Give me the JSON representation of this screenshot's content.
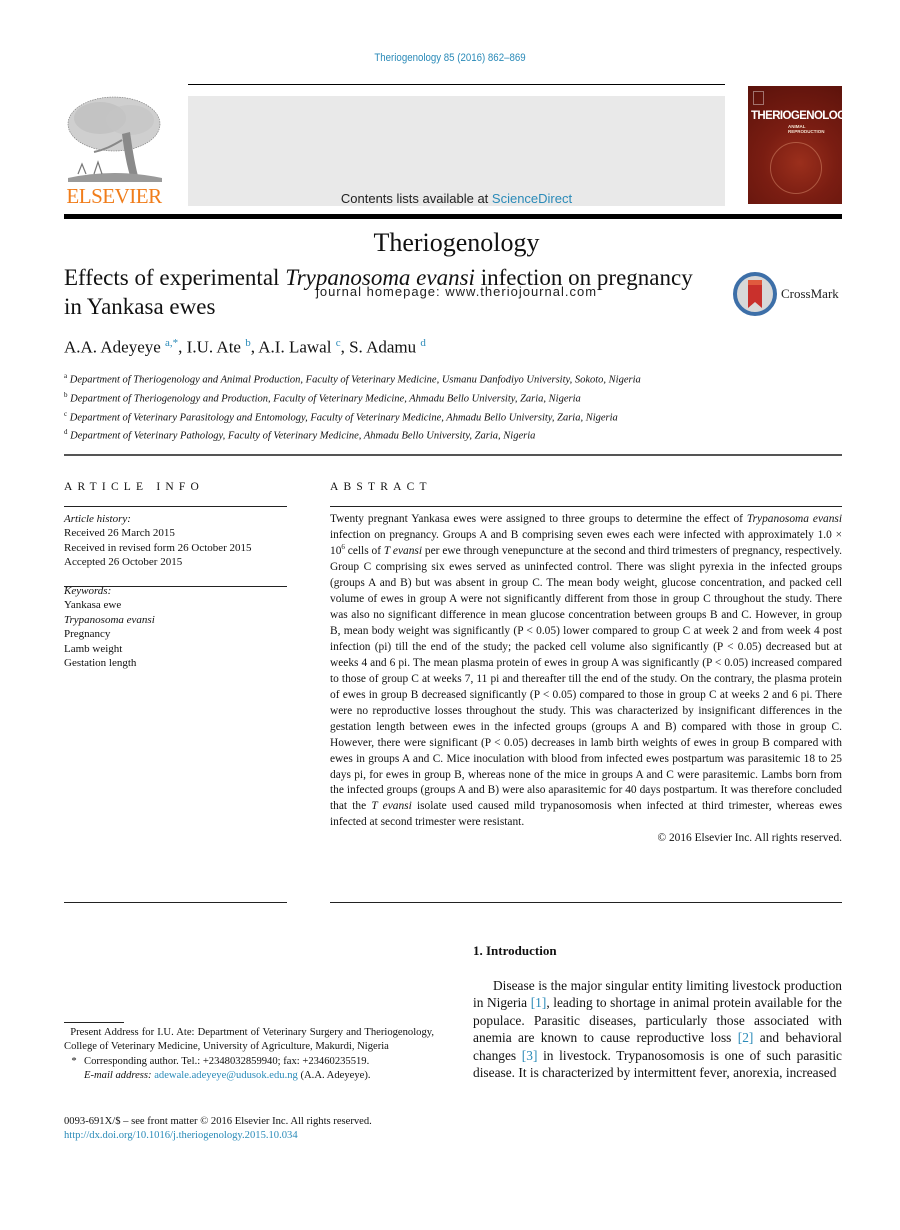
{
  "header": {
    "citation": "Theriogenology 85 (2016) 862–869",
    "contents_prefix": "Contents lists available at ",
    "contents_link": "ScienceDirect",
    "journal_name": "Theriogenology",
    "homepage": "journal homepage: www.theriojournal.com",
    "publisher_logo_text": "ELSEVIER",
    "cover_title": "THERIOGENOLOGY",
    "cover_subtitle": "ANIMAL REPRODUCTION",
    "colors": {
      "link": "#2a8ab8",
      "elsevier_orange": "#f07d1b",
      "masthead_bg": "#e9e9e9",
      "cover": "#7a1d12"
    }
  },
  "article": {
    "title_part1": "Effects of experimental ",
    "title_italic": "Trypanosoma evansi",
    "title_part2": " infection on pregnancy in Yankasa ewes",
    "crossmark_label": "CrossMark",
    "authors": [
      {
        "name": "A.A. Adeyeye",
        "sup": "a,*"
      },
      {
        "name": "I.U. Ate",
        "sup": "b"
      },
      {
        "name": "A.I. Lawal",
        "sup": "c"
      },
      {
        "name": "S. Adamu",
        "sup": "d"
      }
    ],
    "affiliations": [
      {
        "sup": "a",
        "text": "Department of Theriogenology and Animal Production, Faculty of Veterinary Medicine, Usmanu Danfodiyo University, Sokoto, Nigeria"
      },
      {
        "sup": "b",
        "text": "Department of Theriogenology and Production, Faculty of Veterinary Medicine, Ahmadu Bello University, Zaria, Nigeria"
      },
      {
        "sup": "c",
        "text": "Department of Veterinary Parasitology and Entomology, Faculty of Veterinary Medicine, Ahmadu Bello University, Zaria, Nigeria"
      },
      {
        "sup": "d",
        "text": "Department of Veterinary Pathology, Faculty of Veterinary Medicine, Ahmadu Bello University, Zaria, Nigeria"
      }
    ]
  },
  "article_info": {
    "heading": "ARTICLE INFO",
    "history_label": "Article history:",
    "history": [
      "Received 26 March 2015",
      "Received in revised form 26 October 2015",
      "Accepted 26 October 2015"
    ],
    "keywords_label": "Keywords:",
    "keywords": [
      "Yankasa ewe",
      "Trypanosoma evansi",
      "Pregnancy",
      "Lamb weight",
      "Gestation length"
    ]
  },
  "abstract": {
    "heading": "ABSTRACT",
    "p1": "Twenty pregnant Yankasa ewes were assigned to three groups to determine the effect of ",
    "i1": "Trypanosoma evansi",
    "p2": " infection on pregnancy. Groups A and B comprising seven ewes each were infected with approximately 1.0 × 10",
    "sup1": "6",
    "p3": " cells of ",
    "i2": "T evansi",
    "p4": " per ewe through venepuncture at the second and third trimesters of pregnancy, respectively. Group C comprising six ewes served as uninfected control. There was slight pyrexia in the infected groups (groups A and B) but was absent in group C. The mean body weight, glucose concentration, and packed cell volume of ewes in group A were not significantly different from those in group C throughout the study. There was also no significant difference in mean glucose concentration between groups B and C. However, in group B, mean body weight was significantly (P < 0.05) lower compared to group C at week 2 and from week 4 post infection (pi) till the end of the study; the packed cell volume also significantly (P < 0.05) decreased but at weeks 4 and 6 pi. The mean plasma protein of ewes in group A was significantly (P < 0.05) increased compared to those of group C at weeks 7, 11 pi and thereafter till the end of the study. On the contrary, the plasma protein of ewes in group B decreased significantly (P < 0.05) compared to those in group C at weeks 2 and 6 pi. There were no reproductive losses throughout the study. This was characterized by insignificant differences in the gestation length between ewes in the infected groups (groups A and B) compared with those in group C. However, there were significant (P < 0.05) decreases in lamb birth weights of ewes in group B compared with ewes in groups A and C. Mice inoculation with blood from infected ewes postpartum was parasitemic 18 to 25 days pi, for ewes in group B, whereas none of the mice in groups A and C were parasitemic. Lambs born from the infected groups (groups A and B) were also aparasitemic for 40 days postpartum. It was therefore concluded that the ",
    "i3": "T evansi",
    "p5": " isolate used caused mild trypanosomosis when infected at third trimester, whereas ewes infected at second trimester were resistant.",
    "copyright": "© 2016 Elsevier Inc. All rights reserved."
  },
  "introduction": {
    "heading": "1.  Introduction",
    "t1": "Disease is the major singular entity limiting livestock production in Nigeria ",
    "ref1": "[1]",
    "t2": ", leading to shortage in animal protein available for the populace. Parasitic diseases, particularly those associated with anemia are known to cause reproductive loss ",
    "ref2": "[2]",
    "t3": " and behavioral changes ",
    "ref3": "[3]",
    "t4": " in livestock. Trypanosomosis is one of such parasitic disease. It is characterized by intermittent fever, anorexia, increased"
  },
  "footnotes": {
    "present_address": "Present Address for I.U. Ate: Department of Veterinary Surgery and Theriogenology, College of Veterinary Medicine, University of Agriculture, Makurdi, Nigeria",
    "star": "*",
    "corresponding": "Corresponding author. Tel.: +2348032859940; fax: +23460235519.",
    "email_label": "E-mail address: ",
    "email": "adewale.adeyeye@udusok.edu.ng",
    "email_suffix": " (A.A. Adeyeye).",
    "front_matter": "0093-691X/$ – see front matter © 2016 Elsevier Inc. All rights reserved.",
    "doi": "http://dx.doi.org/10.1016/j.theriogenology.2015.10.034"
  }
}
